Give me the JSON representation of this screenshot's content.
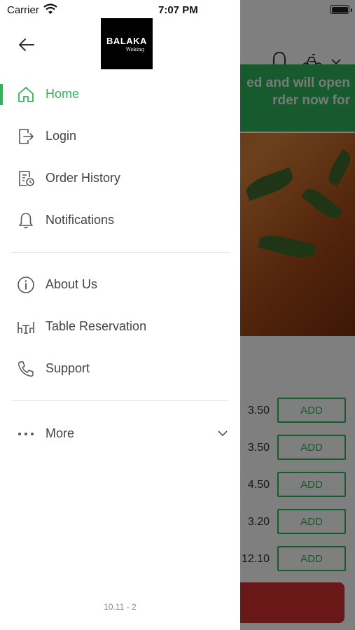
{
  "status_bar": {
    "carrier": "Carrier",
    "time": "7:07 PM"
  },
  "drawer": {
    "logo": {
      "main": "BALAKA",
      "sub": "Woking"
    },
    "menu_primary": [
      {
        "label": "Home",
        "icon": "home-icon",
        "active": true
      },
      {
        "label": "Login",
        "icon": "login-icon"
      },
      {
        "label": "Order History",
        "icon": "order-history-icon"
      },
      {
        "label": "Notifications",
        "icon": "bell-icon"
      }
    ],
    "menu_secondary": [
      {
        "label": "About Us",
        "icon": "info-icon"
      },
      {
        "label": "Table Reservation",
        "icon": "table-icon"
      },
      {
        "label": "Support",
        "icon": "phone-icon"
      }
    ],
    "more_label": "More",
    "version": "10.11 - 2"
  },
  "background": {
    "banner_text": "ed and will open\nrder now for",
    "items": [
      {
        "price": "3.50",
        "add_label": "ADD"
      },
      {
        "price": "3.50",
        "add_label": "ADD"
      },
      {
        "price": "4.50",
        "add_label": "ADD"
      },
      {
        "price": "3.20",
        "add_label": "ADD"
      },
      {
        "price": "12.10",
        "add_label": "ADD"
      }
    ]
  },
  "colors": {
    "accent": "#2fb45a",
    "cart": "#d32f2f",
    "scrim": "rgba(0,0,0,0.5)"
  }
}
